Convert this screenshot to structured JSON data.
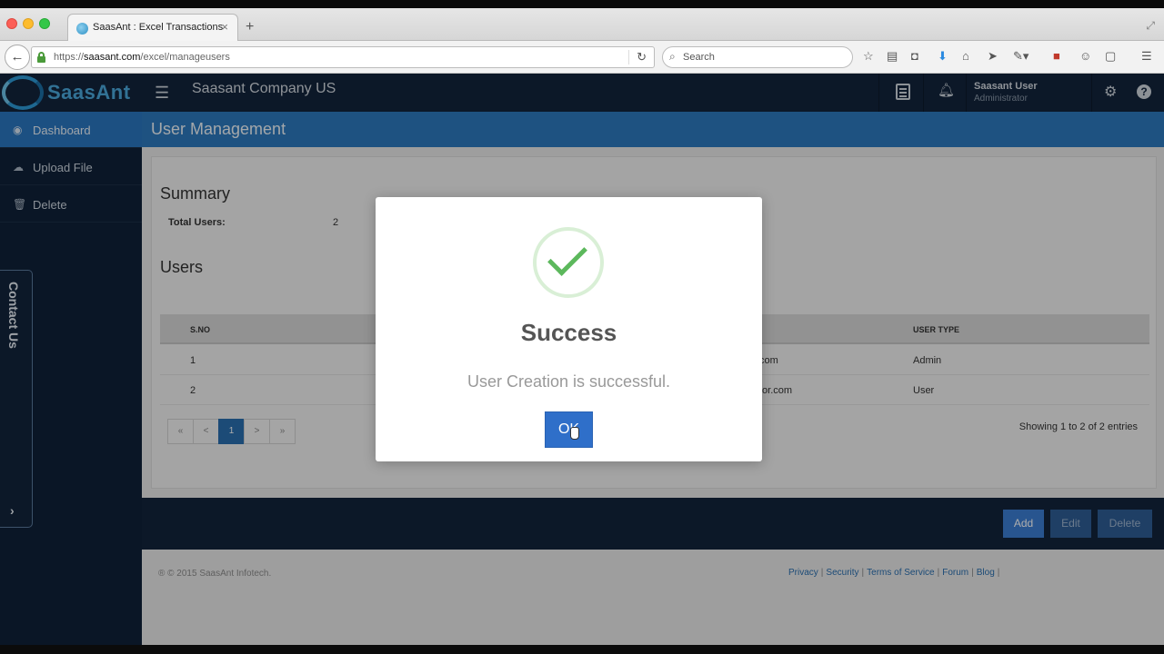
{
  "browser": {
    "tab_title": "SaasAnt : Excel Transactions",
    "tab_close": "×",
    "new_tab": "+",
    "url_prefix": "https://",
    "url_host": "saasant.com",
    "url_path": "/excel/manageusers",
    "search_placeholder": "Search"
  },
  "header": {
    "logo_text": "SaasAnt",
    "company": "Saasant Company US",
    "user_name": "Saasant User",
    "user_role": "Administrator",
    "help": "?"
  },
  "sidebar": {
    "items": [
      {
        "label": "Dashboard",
        "active": true
      },
      {
        "label": "Upload File",
        "active": false
      },
      {
        "label": "Delete",
        "active": false
      }
    ],
    "contact": "Contact Us",
    "expand_arrow": "›"
  },
  "page": {
    "title": "User Management",
    "summary_heading": "Summary",
    "total_users_label": "Total Users:",
    "total_users_value": "2",
    "users_heading": "Users",
    "columns": [
      "S.NO",
      "USER TYPE"
    ],
    "rows": [
      {
        "sno": "1",
        "email_fragment": "com",
        "type": "Admin"
      },
      {
        "sno": "2",
        "email_fragment": "tor.com",
        "type": "User"
      }
    ],
    "pager": [
      "«",
      "<",
      "1",
      ">",
      "»"
    ],
    "pager_active": "1",
    "showing": "Showing 1 to 2 of 2 entries"
  },
  "actions": {
    "add": "Add",
    "edit": "Edit",
    "delete": "Delete"
  },
  "footer": {
    "copyright": "® © 2015 SaasAnt Infotech.",
    "links": [
      "Privacy",
      "Security",
      "Terms of Service",
      "Forum",
      "Blog"
    ]
  },
  "modal": {
    "title": "Success",
    "message": "User Creation is successful.",
    "ok": "OK"
  },
  "colors": {
    "header_bg": "#12243c",
    "accent_blue": "#2d79be",
    "success_green": "#5cb85c"
  }
}
